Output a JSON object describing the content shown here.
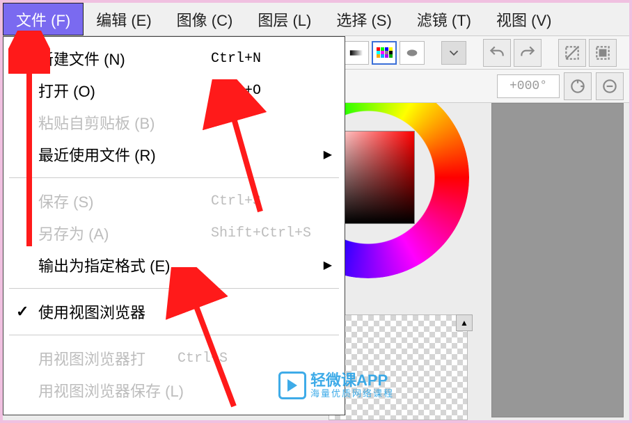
{
  "menubar": [
    {
      "key": "file",
      "label": "文件 (F)",
      "active": true
    },
    {
      "key": "edit",
      "label": "编辑 (E)"
    },
    {
      "key": "image",
      "label": "图像 (C)"
    },
    {
      "key": "layer",
      "label": "图层 (L)"
    },
    {
      "key": "select",
      "label": "选择 (S)"
    },
    {
      "key": "filter",
      "label": "滤镜 (T)"
    },
    {
      "key": "view",
      "label": "视图 (V)"
    }
  ],
  "file_menu": {
    "new": {
      "label": "新建文件 (N)",
      "shortcut": "Ctrl+N"
    },
    "open": {
      "label": "打开 (O)",
      "shortcut": "Ctrl+O"
    },
    "paste_clip": {
      "label": "粘贴自剪贴板 (B)"
    },
    "recent": {
      "label": "最近使用文件 (R)"
    },
    "save": {
      "label": "保存 (S)",
      "shortcut": "Ctrl+S"
    },
    "saveas": {
      "label": "另存为 (A)",
      "shortcut": "Shift+Ctrl+S"
    },
    "export": {
      "label": "输出为指定格式 (E)"
    },
    "use_viewer": {
      "label": "使用视图浏览器"
    },
    "open_viewer": {
      "label": "用视图浏览器打",
      "shortcut": "Ctrl+S"
    },
    "save_viewer": {
      "label": "用视图浏览器保存 (L)"
    }
  },
  "toolbar2": {
    "angle": "+000°"
  },
  "watermark": {
    "title": "轻微课APP",
    "sub": "海量优质网络课程"
  }
}
